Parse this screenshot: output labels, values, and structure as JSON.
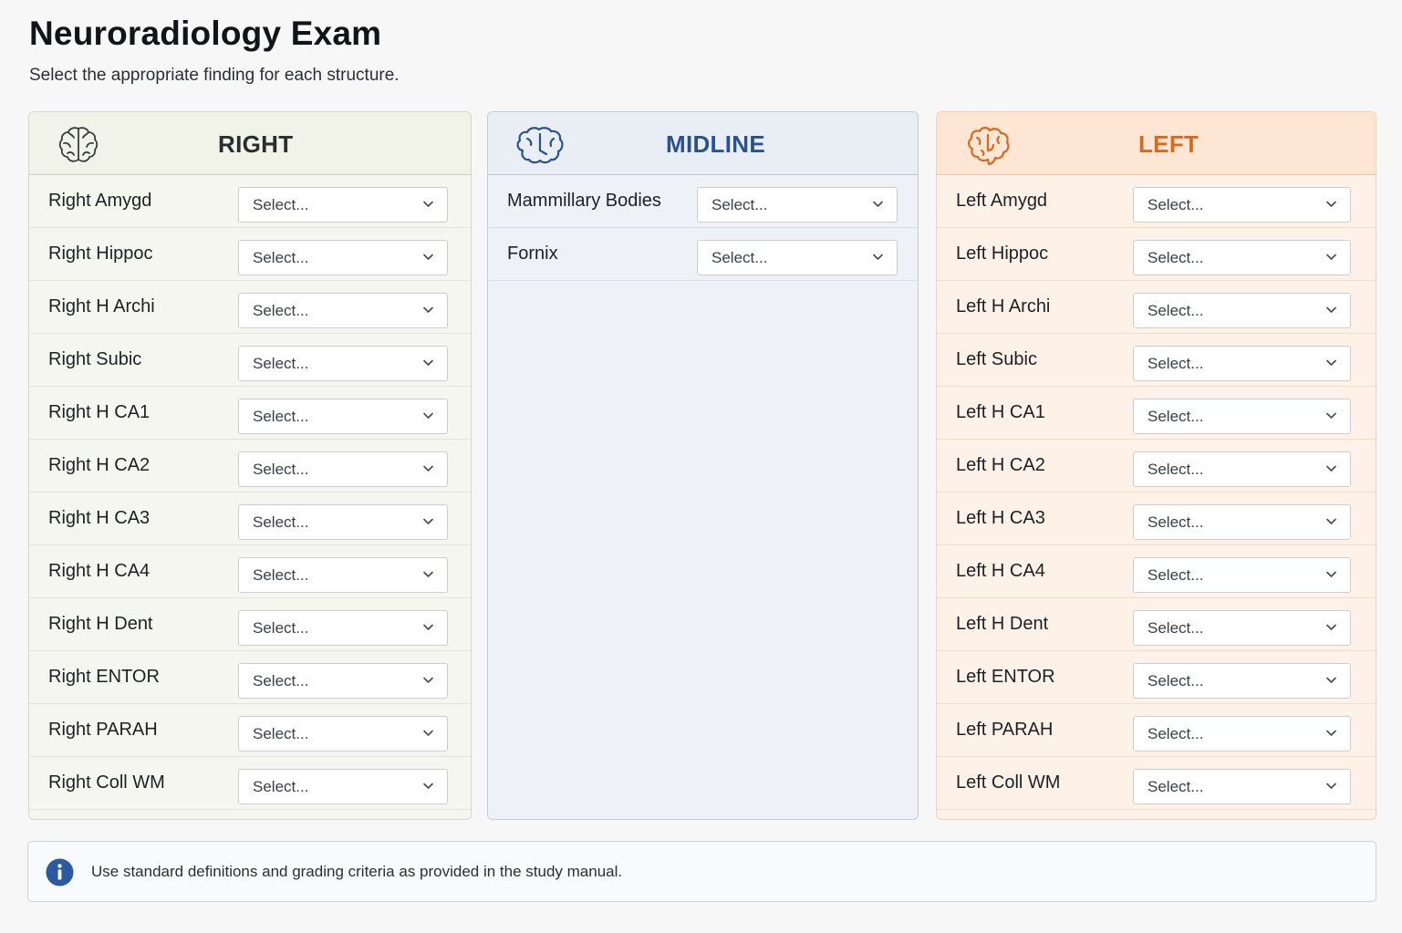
{
  "page": {
    "title": "Neuroradiology Exam",
    "subtitle": "Select the appropriate finding for each structure."
  },
  "colors": {
    "right_accent": "#2a2d30",
    "midline_accent": "#275392",
    "left_accent": "#d9691d"
  },
  "panels": {
    "right": {
      "title": "RIGHT",
      "icon": "brain-icon",
      "rows": [
        {
          "label": "Right Amygd",
          "value": "Select..."
        },
        {
          "label": "Right Hippoc",
          "value": "Select..."
        },
        {
          "label": "Right H Archi",
          "value": "Select..."
        },
        {
          "label": "Right Subic",
          "value": "Select..."
        },
        {
          "label": "Right H CA1",
          "value": "Select..."
        },
        {
          "label": "Right H CA2",
          "value": "Select..."
        },
        {
          "label": "Right H CA3",
          "value": "Select..."
        },
        {
          "label": "Right H CA4",
          "value": "Select..."
        },
        {
          "label": "Right H Dent",
          "value": "Select..."
        },
        {
          "label": "Right ENTOR",
          "value": "Select..."
        },
        {
          "label": "Right PARAH",
          "value": "Select..."
        },
        {
          "label": "Right Coll WM",
          "value": "Select..."
        }
      ]
    },
    "midline": {
      "title": "MIDLINE",
      "icon": "brain-icon",
      "rows": [
        {
          "label": "Mammillary Bodies",
          "value": "Select..."
        },
        {
          "label": "Fornix",
          "value": "Select..."
        }
      ]
    },
    "left": {
      "title": "LEFT",
      "icon": "brain-icon",
      "rows": [
        {
          "label": "Left Amygd",
          "value": "Select..."
        },
        {
          "label": "Left Hippoc",
          "value": "Select..."
        },
        {
          "label": "Left H Archi",
          "value": "Select..."
        },
        {
          "label": "Left Subic",
          "value": "Select..."
        },
        {
          "label": "Left H CA1",
          "value": "Select..."
        },
        {
          "label": "Left H CA2",
          "value": "Select..."
        },
        {
          "label": "Left H CA3",
          "value": "Select..."
        },
        {
          "label": "Left H CA4",
          "value": "Select..."
        },
        {
          "label": "Left H Dent",
          "value": "Select..."
        },
        {
          "label": "Left ENTOR",
          "value": "Select..."
        },
        {
          "label": "Left PARAH",
          "value": "Select..."
        },
        {
          "label": "Left Coll WM",
          "value": "Select..."
        }
      ]
    }
  },
  "info": {
    "icon": "info-icon",
    "text": "Use standard definitions and grading criteria as provided in the study manual."
  }
}
